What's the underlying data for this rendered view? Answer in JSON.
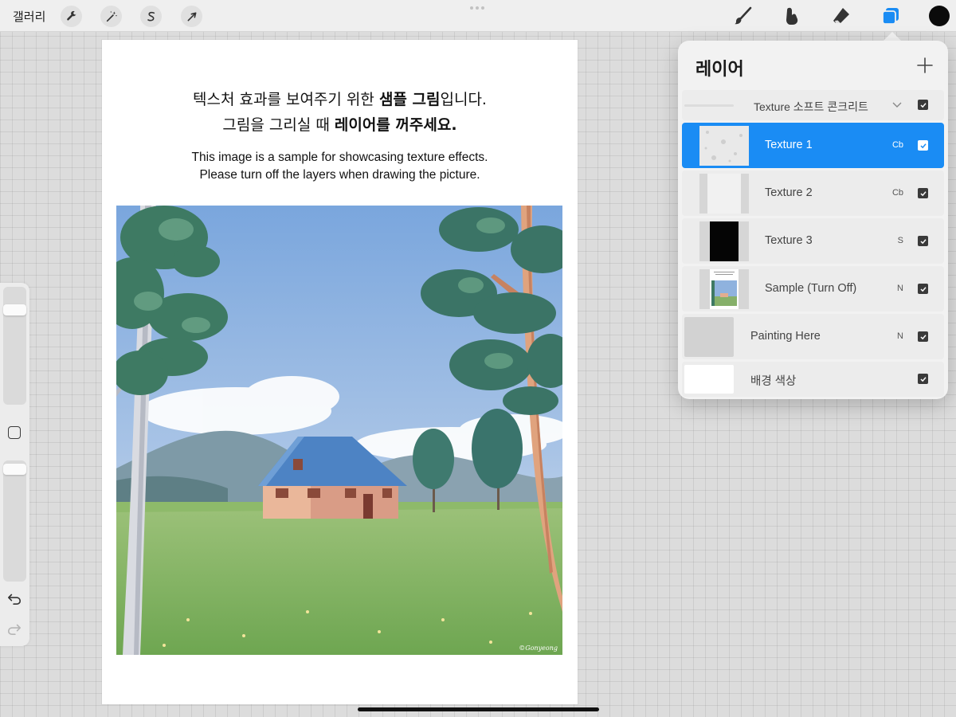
{
  "toolbar": {
    "gallery_label": "갤러리",
    "left_tools": [
      "wrench-icon",
      "magic-wand-icon",
      "selection-s-icon",
      "arrow-transform-icon"
    ],
    "right_tools": [
      "brush-icon",
      "smudge-icon",
      "eraser-icon",
      "layers-icon"
    ],
    "accent": "#1a8cf4",
    "current_color": "#0b0b0b"
  },
  "canvas": {
    "ko_line1_a": "텍스처 효과를 보여주기 위한 ",
    "ko_line1_b": "샘플 그림",
    "ko_line1_c": "입니다.",
    "ko_line2_a": "그림을 그리실 때 ",
    "ko_line2_b": "레이어를 꺼주세요.",
    "en_line1": "This image is a sample for showcasing texture effects.",
    "en_line2": "Please turn off the layers when drawing the picture.",
    "signature": "©Gonyeong"
  },
  "layers": {
    "title": "레이어",
    "group": {
      "name": "Texture 소프트 콘크리트",
      "checked": true
    },
    "items": [
      {
        "name": "Texture 1",
        "blend": "Cb",
        "checked": true,
        "selected": true
      },
      {
        "name": "Texture 2",
        "blend": "Cb",
        "checked": true,
        "selected": false
      },
      {
        "name": "Texture 3",
        "blend": "S",
        "checked": true,
        "selected": false
      },
      {
        "name": "Sample (Turn Off)",
        "blend": "N",
        "checked": true,
        "selected": false
      },
      {
        "name": "Painting Here",
        "blend": "N",
        "checked": true,
        "selected": false
      },
      {
        "name": "배경 색상",
        "blend": "",
        "checked": true,
        "selected": false
      }
    ]
  }
}
